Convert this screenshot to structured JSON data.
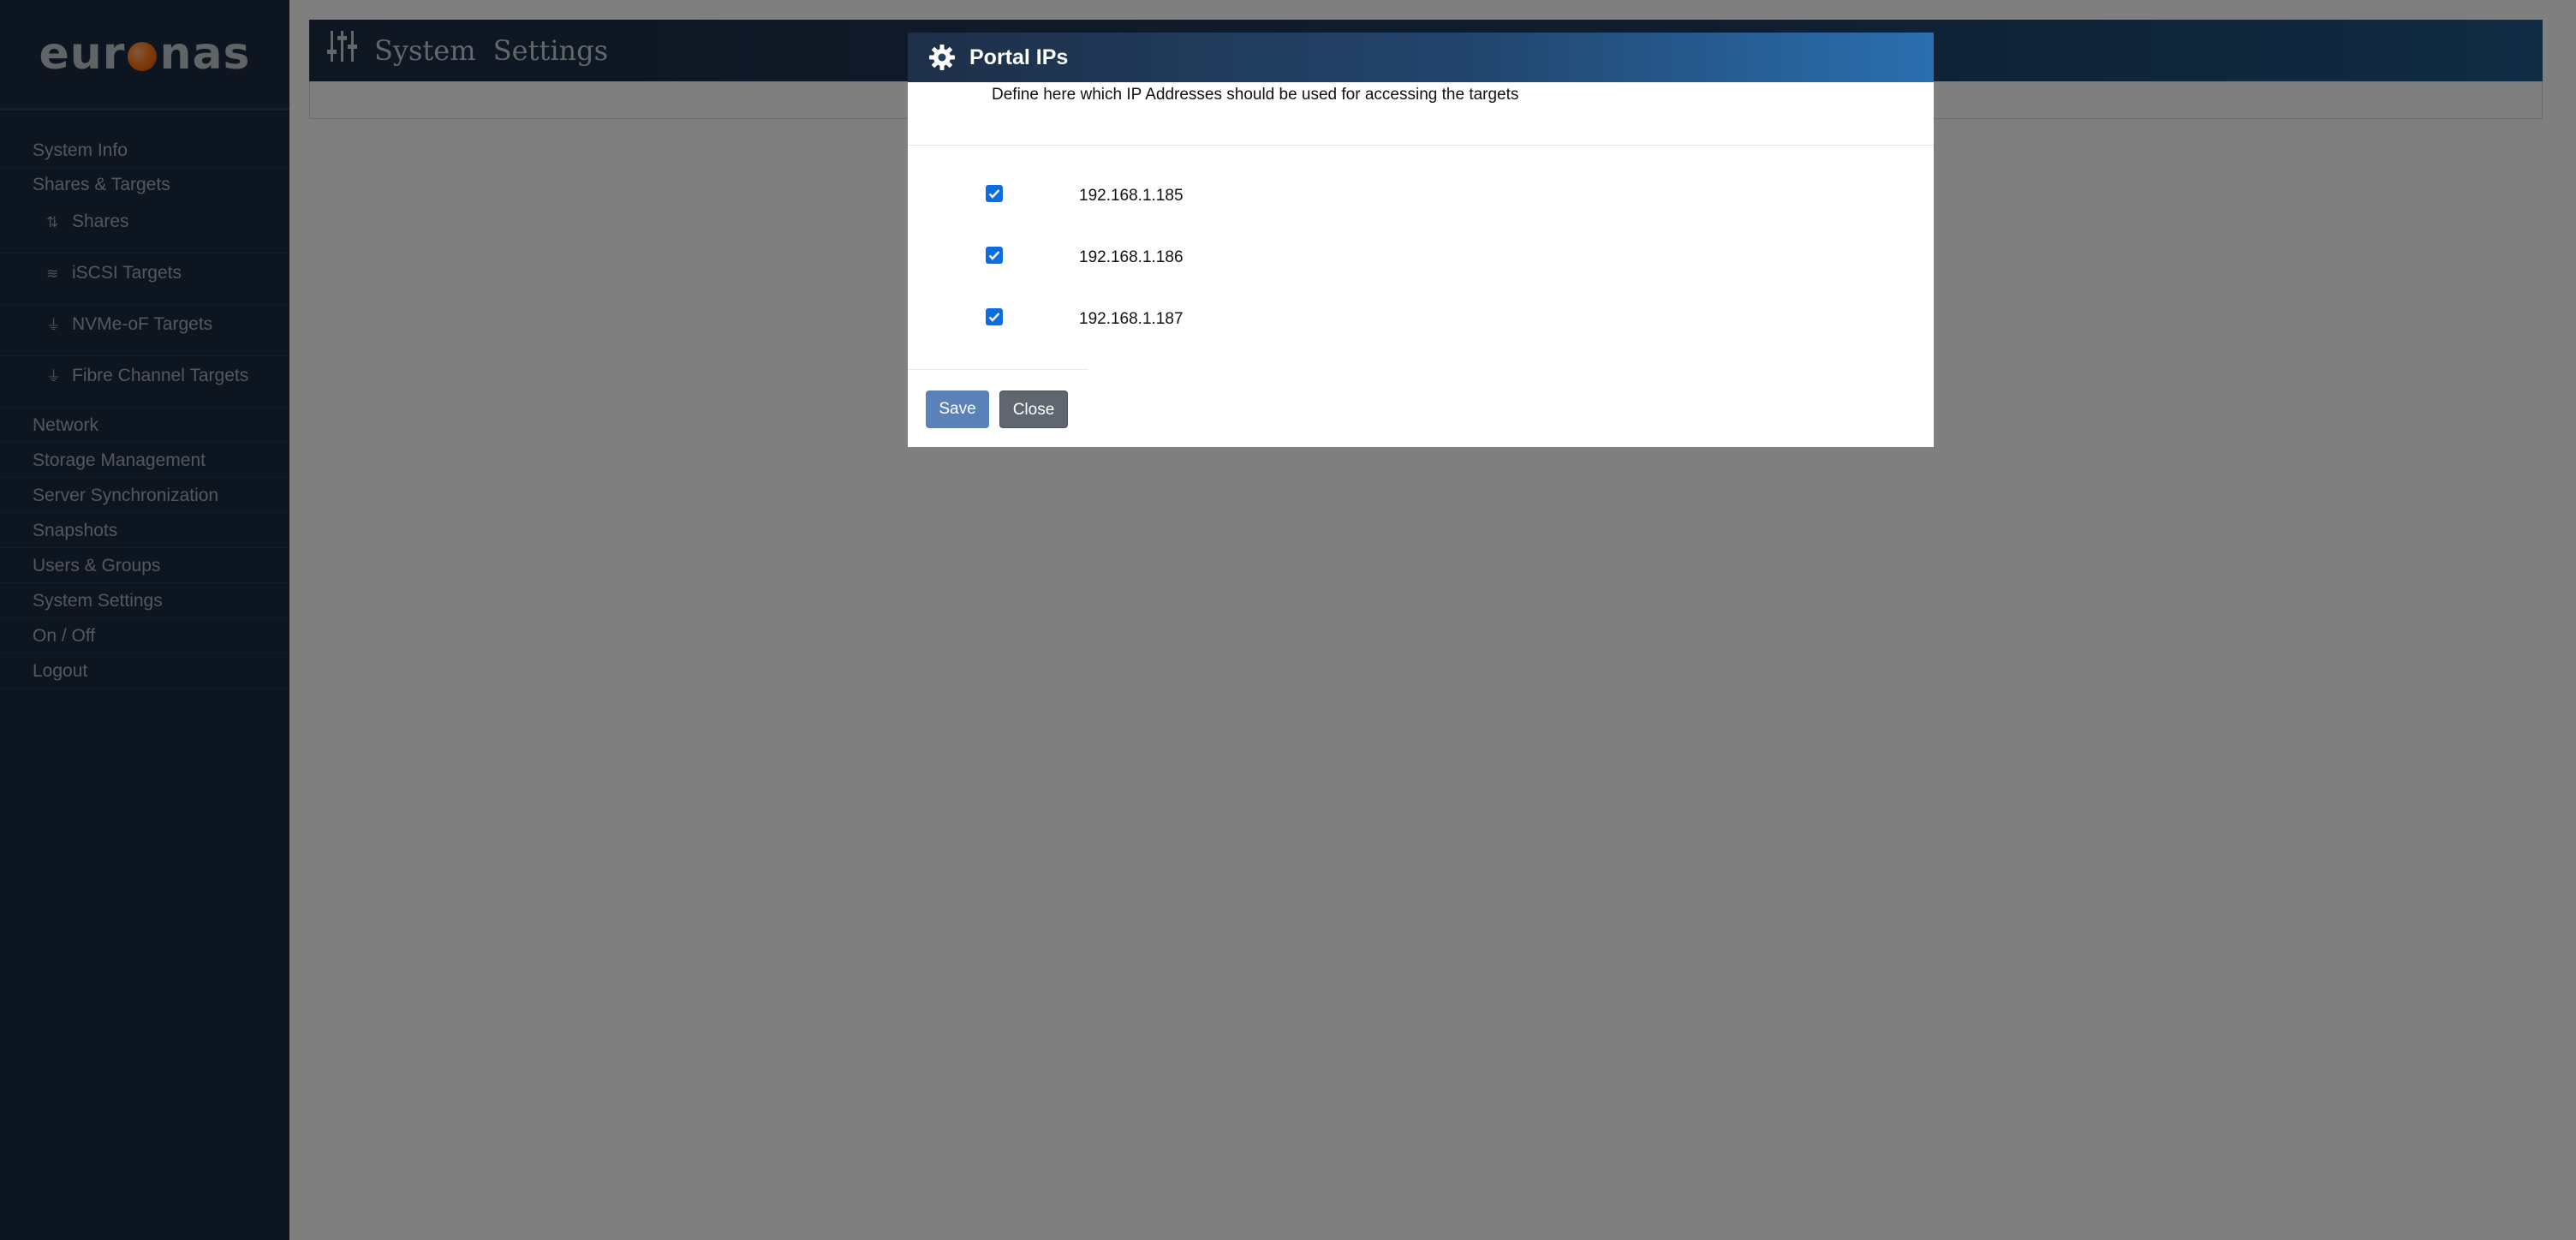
{
  "sidebar": {
    "logo": {
      "left": "eur",
      "right": "nas"
    },
    "items": [
      {
        "label": "System Info"
      },
      {
        "label": "Shares & Targets"
      }
    ],
    "subitems": [
      {
        "label": "Shares",
        "icon": "sort-arrows-icon"
      },
      {
        "label": "iSCSI Targets",
        "icon": "layers-icon"
      },
      {
        "label": "NVMe-oF Targets",
        "icon": "network-node-icon"
      },
      {
        "label": "Fibre Channel Targets",
        "icon": "network-node-icon"
      }
    ],
    "items_after": [
      {
        "label": "Network"
      },
      {
        "label": "Storage Management"
      },
      {
        "label": "Server Synchronization"
      },
      {
        "label": "Snapshots"
      },
      {
        "label": "Users & Groups"
      },
      {
        "label": "System Settings"
      },
      {
        "label": "On / Off"
      },
      {
        "label": "Logout"
      }
    ]
  },
  "header": {
    "title": "System Settings",
    "icon": "sliders-icon"
  },
  "modal": {
    "title": "Portal IPs",
    "icon": "gear-icon",
    "description": "Define here which IP Addresses should be used for accessing the targets",
    "ips": [
      {
        "address": "192.168.1.185",
        "checked": true
      },
      {
        "address": "192.168.1.186",
        "checked": true
      },
      {
        "address": "192.168.1.187",
        "checked": true
      }
    ],
    "save_label": "Save",
    "close_label": "Close"
  },
  "colors": {
    "sidebar_bg": "#1a2b42",
    "accent": "#2a6fb0",
    "logo_dot": "#ff7a1a",
    "save_button": "#5b82b8",
    "close_button": "#5f6670",
    "checkbox": "#0b6de0"
  }
}
